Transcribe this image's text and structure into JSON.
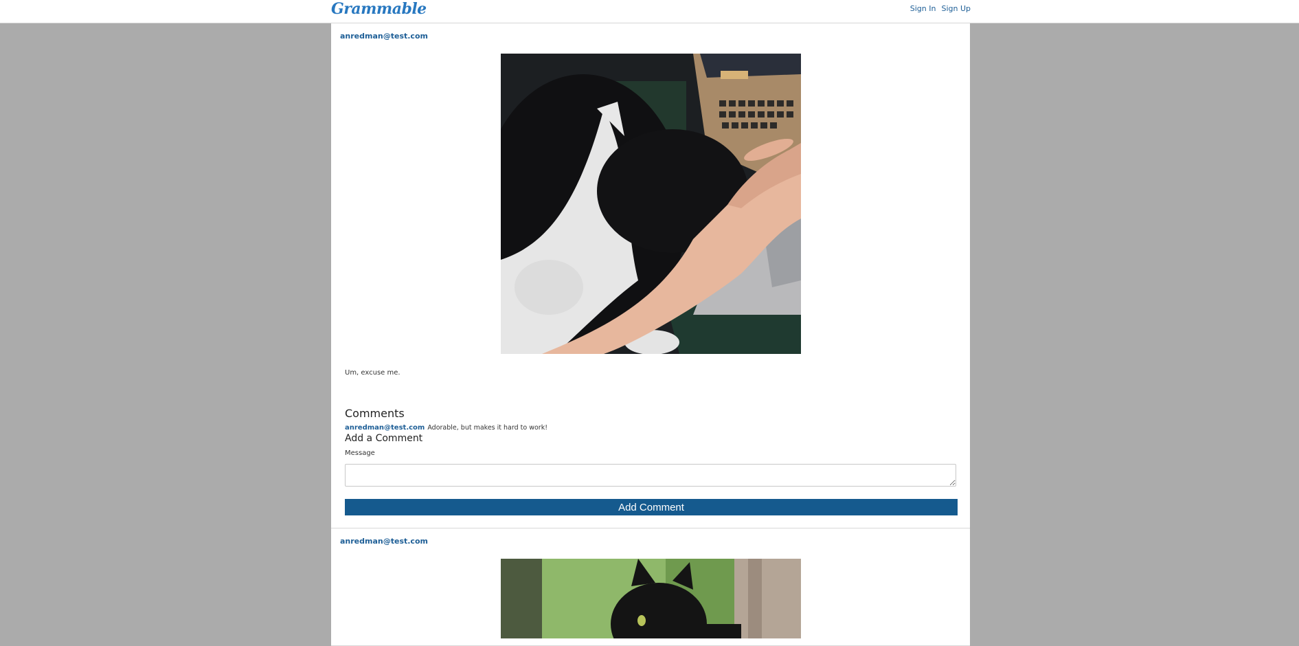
{
  "navbar": {
    "brand": "Grammable",
    "sign_in": "Sign In",
    "sign_up": "Sign Up"
  },
  "posts": [
    {
      "author": "anredman@test.com",
      "photo_alt": "black-and-white cat sleeping on a laptop keyboard",
      "caption": "Um, excuse me.",
      "comments_heading": "Comments",
      "comments": [
        {
          "author": "anredman@test.com",
          "text": "Adorable, but makes it hard to work!"
        }
      ],
      "add_comment_heading": "Add a Comment",
      "message_label": "Message",
      "message_value": "",
      "submit_label": "Add Comment"
    },
    {
      "author": "anredman@test.com",
      "photo_alt": "black cat in a tree"
    }
  ],
  "colors": {
    "brand": "#2878c0",
    "link": "#1d5e96",
    "button": "#155a8e",
    "page_background": "#ababab"
  }
}
